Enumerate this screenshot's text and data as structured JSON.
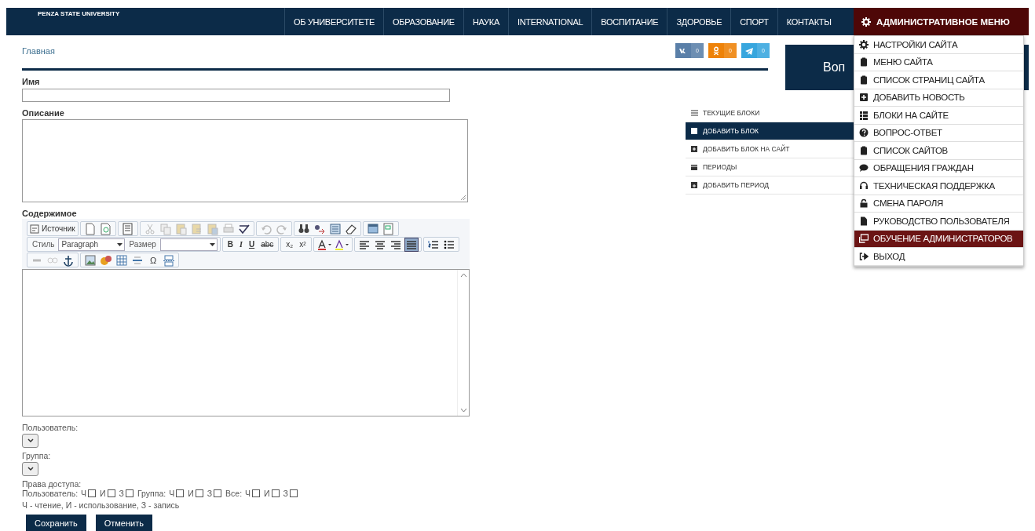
{
  "header": {
    "logo": "PENZA STATE UNIVERSITY",
    "nav": [
      {
        "label": "ОБ УНИВЕРСИТЕТЕ",
        "selected": false
      },
      {
        "label": "ОБРАЗОВАНИЕ",
        "selected": false
      },
      {
        "label": "НАУКА",
        "selected": false
      },
      {
        "label": "INTERNATIONAL",
        "selected": false
      },
      {
        "label": "ВОСПИТАНИЕ",
        "selected": false
      },
      {
        "label": "ЗДОРОВЬЕ",
        "selected": false
      },
      {
        "label": "СПОРТ",
        "selected": false
      },
      {
        "label": "КОНТАКТЫ",
        "selected": false
      }
    ],
    "admin_menu": {
      "label": "АДМИНИСТРАТИВНОЕ МЕНЮ",
      "expanded": true,
      "items": [
        {
          "label": "НАСТРОЙКИ САЙТА",
          "selected": false
        },
        {
          "label": "МЕНЮ САЙТА",
          "selected": false
        },
        {
          "label": "СПИСОК СТРАНИЦ САЙТА",
          "selected": false
        },
        {
          "label": "ДОБАВИТЬ НОВОСТЬ",
          "selected": false
        },
        {
          "label": "БЛОКИ НА САЙТЕ",
          "selected": false
        },
        {
          "label": "ВОПРОС-ОТВЕТ",
          "selected": false
        },
        {
          "label": "СПИСОК САЙТОВ",
          "selected": false
        },
        {
          "label": "ОБРАЩЕНИЯ ГРАЖДАН",
          "selected": false
        },
        {
          "label": "ТЕХНИЧЕСКАЯ ПОДДЕРЖКА",
          "selected": false
        },
        {
          "label": "СМЕНА ПАРОЛЯ",
          "selected": false
        },
        {
          "label": "РУКОВОДСТВО ПОЛЬЗОВАТЕЛЯ",
          "selected": false
        },
        {
          "label": "ОБУЧЕНИЕ АДМИНИСТРАТОРОВ",
          "selected": true
        },
        {
          "label": "ВЫХОД",
          "selected": false
        }
      ]
    }
  },
  "breadcrumb": "Главная",
  "share": [
    {
      "kind": "vk",
      "count": "0"
    },
    {
      "kind": "ok",
      "count": "0"
    },
    {
      "kind": "telegram",
      "count": "0"
    }
  ],
  "banner": {
    "text": "Воп"
  },
  "side_menu": [
    {
      "label": "ТЕКУЩИЕ БЛОКИ",
      "selected": false
    },
    {
      "label": "ДОБАВИТЬ БЛОК",
      "selected": true
    },
    {
      "label": "ДОБАВИТЬ БЛОК НА САЙТ",
      "selected": false
    },
    {
      "label": "ПЕРИОДЫ",
      "selected": false
    },
    {
      "label": "ДОБАВИТЬ ПЕРИОД",
      "selected": false
    }
  ],
  "fields": [
    {
      "kind": "input",
      "label": "Имя"
    },
    {
      "kind": "textarea",
      "label": "Описание"
    }
  ],
  "editor": {
    "label": "Содержимое",
    "source": "Источник",
    "style_label": "Стиль",
    "style_value": "Paragraph",
    "size_label": "Размер",
    "format_buttons": [
      {
        "kind": "bold",
        "label": "B"
      },
      {
        "kind": "italic",
        "label": "I"
      },
      {
        "kind": "underline",
        "label": "U"
      },
      {
        "kind": "strike",
        "label": "abc"
      },
      {
        "kind": "subscript",
        "label": "x₂"
      },
      {
        "kind": "superscript",
        "label": "x²"
      }
    ],
    "align_buttons": [
      {
        "kind": "left",
        "selected": false
      },
      {
        "kind": "center",
        "selected": false
      },
      {
        "kind": "right",
        "selected": false
      },
      {
        "kind": "justify",
        "selected": true
      }
    ],
    "special_char": "Ω"
  },
  "selects": [
    {
      "label": "Пользователь:"
    },
    {
      "label": "Группа:"
    }
  ],
  "permissions": {
    "label": "Права доступа:",
    "groups": [
      {
        "label": "Пользователь:",
        "boxes": [
          {
            "label": "Ч",
            "checked": false
          },
          {
            "label": "И",
            "checked": false
          },
          {
            "label": "З",
            "checked": false
          }
        ]
      },
      {
        "label": "Группа:",
        "boxes": [
          {
            "label": "Ч",
            "checked": false
          },
          {
            "label": "И",
            "checked": false
          },
          {
            "label": "З",
            "checked": false
          }
        ]
      },
      {
        "label": "Все:",
        "boxes": [
          {
            "label": "Ч",
            "checked": false
          },
          {
            "label": "И",
            "checked": false
          },
          {
            "label": "З",
            "checked": false
          }
        ]
      }
    ],
    "legend": "Ч - чтение, И - использование, З - запись"
  },
  "buttons": [
    "Сохранить",
    "Отменить"
  ]
}
